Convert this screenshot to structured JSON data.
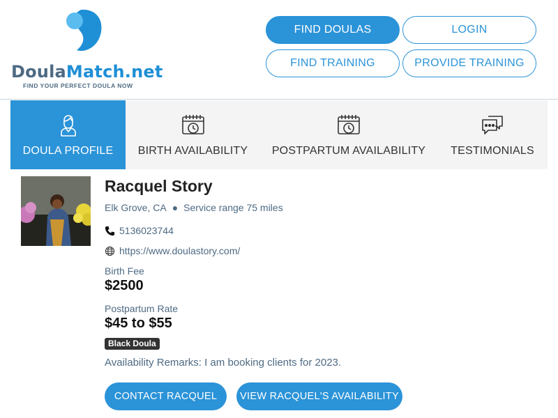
{
  "brand": {
    "name_part1": "Doula",
    "name_part2": "Match.net",
    "tagline": "FIND YOUR PERFECT DOULA NOW",
    "colors": {
      "primary": "#2b93d8",
      "slate": "#4e6a83",
      "logo_light": "#5bbcf0"
    }
  },
  "nav": {
    "find_doulas": "FIND DOULAS",
    "login": "LOGIN",
    "find_training": "FIND TRAINING",
    "provide_training": "PROVIDE TRAINING"
  },
  "tabs": [
    {
      "label": "DOULA PROFILE",
      "icon": "person-icon",
      "active": true
    },
    {
      "label": "BIRTH AVAILABILITY",
      "icon": "calendar-clock-icon",
      "active": false
    },
    {
      "label": "POSTPARTUM AVAILABILITY",
      "icon": "calendar-clock-icon",
      "active": false
    },
    {
      "label": "TESTIMONIALS",
      "icon": "chat-bubbles-icon",
      "active": false
    }
  ],
  "profile": {
    "name": "Racquel Story",
    "location": "Elk Grove, CA",
    "service_range": "Service range 75 miles",
    "phone": "5136023744",
    "website": "https://www.doulastory.com/",
    "birth_fee_label": "Birth Fee",
    "birth_fee": "$2500",
    "postpartum_rate_label": "Postpartum Rate",
    "postpartum_rate": "$45 to $55",
    "badge": "Black Doula",
    "availability_remarks": "Availability Remarks: I am booking clients for 2023."
  },
  "actions": {
    "contact": "CONTACT RACQUEL",
    "view_availability": "VIEW RACQUEL'S AVAILABILITY"
  }
}
